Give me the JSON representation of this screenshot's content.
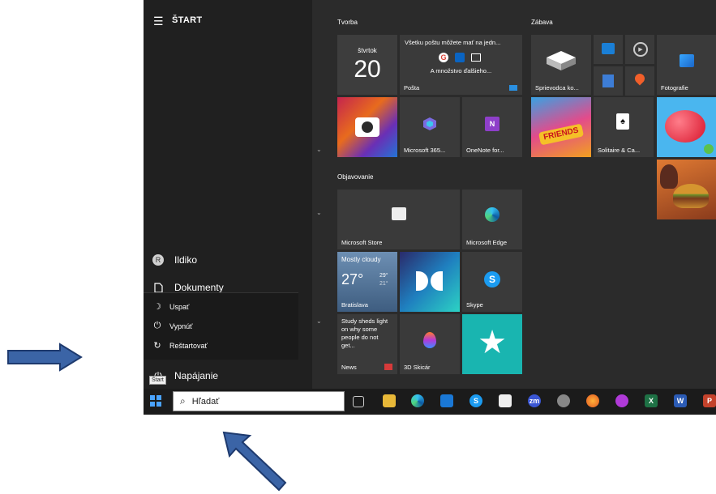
{
  "start_menu": {
    "title": "ŠTART",
    "user": "Ildiko",
    "avatar_letter": "R",
    "documents": "Dokumenty",
    "power": "Napájanie",
    "tooltip": "Štart",
    "power_menu": [
      "Uspať",
      "Vypnúť",
      "Reštartovať"
    ]
  },
  "groups": {
    "tvorba": "Tvorba",
    "zabava": "Zábava",
    "objavovanie": "Objavovanie"
  },
  "tiles": {
    "calendar_day": "štvrtok",
    "calendar_date": "20",
    "mail_text": "Všetku poštu môžete mať na jedn...",
    "mail_more": "A množstvo ďalšieho...",
    "mail_label": "Pošta",
    "office_label": "Microsoft 365...",
    "onenote_label": "OneNote for...",
    "xbox_label": "Sprievodca ko...",
    "photos_label": "Fotografie",
    "solitaire_label": "Solitaire & Ca...",
    "store_label": "Microsoft Store",
    "edge_label": "Microsoft Edge",
    "weather_cond": "Mostly cloudy",
    "weather_temp": "27°",
    "weather_hi": "29°",
    "weather_lo": "21°",
    "weather_city": "Bratislava",
    "skype_label": "Skype",
    "news_text": "Study sheds light on why some people do not get...",
    "news_label": "News",
    "paint3d_label": "3D Skicár",
    "friends_text": "FRIENDS"
  },
  "taskbar": {
    "search_placeholder": "Hľadať",
    "zoom_label": "zm"
  }
}
